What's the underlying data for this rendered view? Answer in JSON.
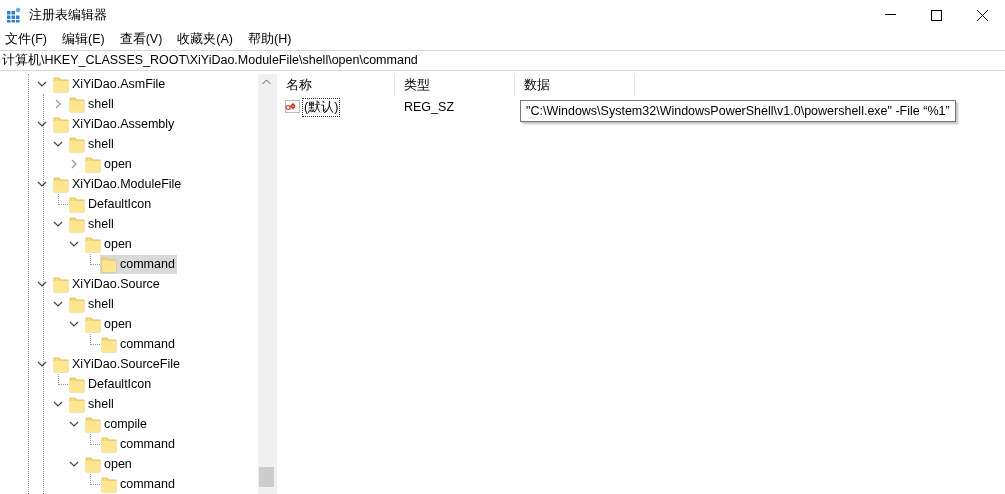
{
  "window": {
    "title": "注册表编辑器"
  },
  "menu": [
    "文件(F)",
    "编辑(E)",
    "查看(V)",
    "收藏夹(A)",
    "帮助(H)"
  ],
  "address": "计算机\\HKEY_CLASSES_ROOT\\XiYiDao.ModuleFile\\shell\\open\\command",
  "tree": [
    {
      "label": "XiYiDao.AsmFile",
      "kind": "branch",
      "expanded": true,
      "selected": false,
      "children": [
        {
          "label": "shell",
          "kind": "branch",
          "expanded": false,
          "selected": false
        }
      ]
    },
    {
      "label": "XiYiDao.Assembly",
      "kind": "branch",
      "expanded": true,
      "selected": false,
      "children": [
        {
          "label": "shell",
          "kind": "branch",
          "expanded": true,
          "selected": false,
          "children": [
            {
              "label": "open",
              "kind": "branch",
              "expanded": false,
              "selected": false
            }
          ]
        }
      ]
    },
    {
      "label": "XiYiDao.ModuleFile",
      "kind": "branch",
      "expanded": true,
      "selected": false,
      "children": [
        {
          "label": "DefaultIcon",
          "kind": "leaf",
          "selected": false
        },
        {
          "label": "shell",
          "kind": "branch",
          "expanded": true,
          "selected": false,
          "children": [
            {
              "label": "open",
              "kind": "branch",
              "expanded": true,
              "selected": false,
              "children": [
                {
                  "label": "command",
                  "kind": "leaf",
                  "selected": true
                }
              ]
            }
          ]
        }
      ]
    },
    {
      "label": "XiYiDao.Source",
      "kind": "branch",
      "expanded": true,
      "selected": false,
      "children": [
        {
          "label": "shell",
          "kind": "branch",
          "expanded": true,
          "selected": false,
          "children": [
            {
              "label": "open",
              "kind": "branch",
              "expanded": true,
              "selected": false,
              "children": [
                {
                  "label": "command",
                  "kind": "leaf",
                  "selected": false
                }
              ]
            }
          ]
        }
      ]
    },
    {
      "label": "XiYiDao.SourceFile",
      "kind": "branch",
      "expanded": true,
      "selected": false,
      "children": [
        {
          "label": "DefaultIcon",
          "kind": "leaf",
          "selected": false
        },
        {
          "label": "shell",
          "kind": "branch",
          "expanded": true,
          "selected": false,
          "children": [
            {
              "label": "compile",
              "kind": "branch",
              "expanded": true,
              "selected": false,
              "children": [
                {
                  "label": "command",
                  "kind": "leaf",
                  "selected": false
                }
              ]
            },
            {
              "label": "open",
              "kind": "branch",
              "expanded": true,
              "selected": false,
              "children": [
                {
                  "label": "command",
                  "kind": "leaf",
                  "selected": false
                }
              ]
            }
          ]
        }
      ]
    }
  ],
  "list": {
    "columns": [
      "名称",
      "类型",
      "数据"
    ],
    "rows": [
      {
        "name": "(默认)",
        "type": "REG_SZ",
        "data": "\"C:\\Windows\\System32\\WindowsPowerShell\\v1.0\\powershell.exe\" -File “%1”"
      }
    ]
  }
}
